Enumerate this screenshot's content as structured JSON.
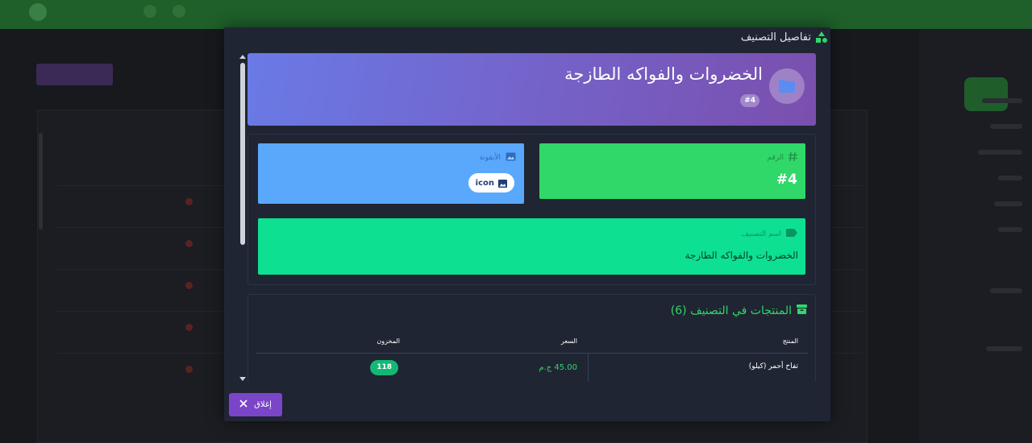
{
  "modal": {
    "title": "تفاصيل التصنيف",
    "close_label": "إغلاق"
  },
  "hero": {
    "title": "الخضروات والفواكه الطازجة",
    "badge": "#4"
  },
  "cards": {
    "number": {
      "label": "الرقم",
      "value": "#4"
    },
    "icon": {
      "label": "الأيقونة",
      "value": "icon"
    },
    "name": {
      "label": "اسم التصنيف",
      "value": "الخضروات والفواكه الطازجة"
    }
  },
  "products": {
    "title": "المنتجات في التصنيف (6)",
    "headers": {
      "product": "المنتج",
      "price": "السعر",
      "stock": "المخزون"
    },
    "rows": [
      {
        "name": "تفاح أحمر (كيلو)",
        "price": "45.00 ج.م",
        "stock": "118"
      }
    ]
  },
  "colors": {
    "modal_bg": "#1f2533",
    "number_card": "#2fd868",
    "icon_card": "#5aa8fc",
    "name_card": "#0ee092",
    "close_button": "#7a45c9"
  }
}
